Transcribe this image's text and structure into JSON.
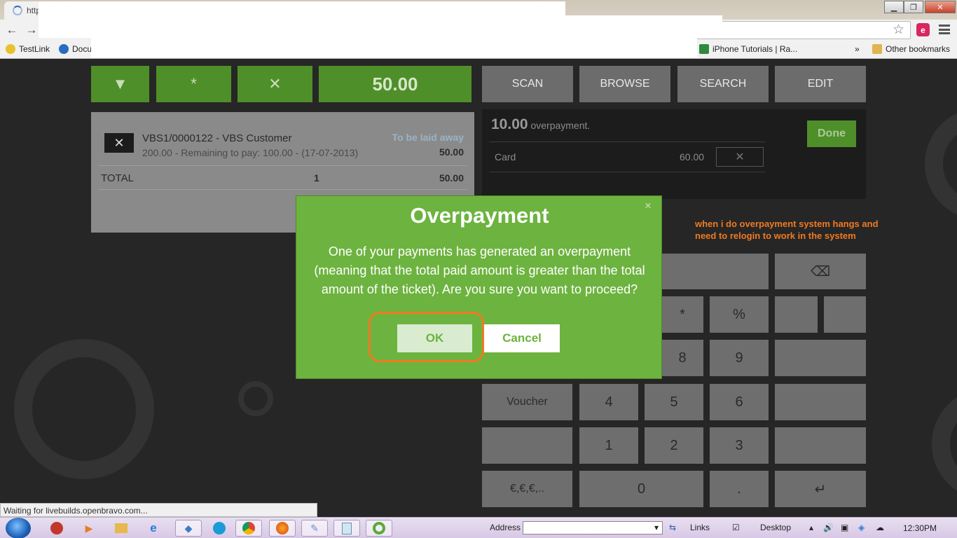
{
  "browser": {
    "tab_title": "http",
    "bookmarks": [
      {
        "label": "TestLink"
      },
      {
        "label": "Docu"
      },
      {
        "label": "iPhone Tutorials | Ra..."
      },
      {
        "label": "Other bookmarks"
      }
    ],
    "bookmarks_overflow": "»",
    "status_text": "Waiting for livebuilds.openbravo.com..."
  },
  "pos": {
    "toolbar": {
      "down_symbol": "▼",
      "star_symbol": "*",
      "delete_symbol": "✕",
      "total_amount": "50.00"
    },
    "tabs": [
      "SCAN",
      "BROWSE",
      "SEARCH",
      "EDIT"
    ],
    "receipt": {
      "line_name": "VBS1/0000122 - VBS Customer",
      "line_detail": "200.00 - Remaining to pay: 100.00 - (17-07-2013)",
      "line_status": "To be laid away",
      "line_amount": "50.00",
      "total_label": "TOTAL",
      "total_qty": "1",
      "total_amount": "50.00"
    },
    "payment": {
      "overpayment_amount": "10.00",
      "overpayment_label": "overpayment.",
      "done_label": "Done",
      "method": "Card",
      "method_amount": "60.00"
    },
    "keypad": {
      "backspace": "⌫",
      "asterisk": "*",
      "percent": "%",
      "eight": "8",
      "nine": "9",
      "voucher": "Voucher",
      "four": "4",
      "five": "5",
      "six": "6",
      "one": "1",
      "two": "2",
      "three": "3",
      "currency": "€,€,€,..",
      "zero": "0",
      "dot": ".",
      "enter": "↵"
    }
  },
  "annotation": "when i do overpayment system hangs and need to relogin to work in the system",
  "dialog": {
    "title": "Overpayment",
    "message": "One of your payments has generated an overpayment (meaning that the total paid amount is greater than the total amount of the ticket). Are you sure you want to proceed?",
    "ok_label": "OK",
    "cancel_label": "Cancel",
    "close_symbol": "×"
  },
  "taskbar": {
    "address_label": "Address",
    "links_label": "Links",
    "desktop_label": "Desktop",
    "clock": "12:30PM"
  },
  "colors": {
    "dialog_green": "#6db33f",
    "button_green": "#4f8f2a",
    "annotation_orange": "#f07a22"
  }
}
